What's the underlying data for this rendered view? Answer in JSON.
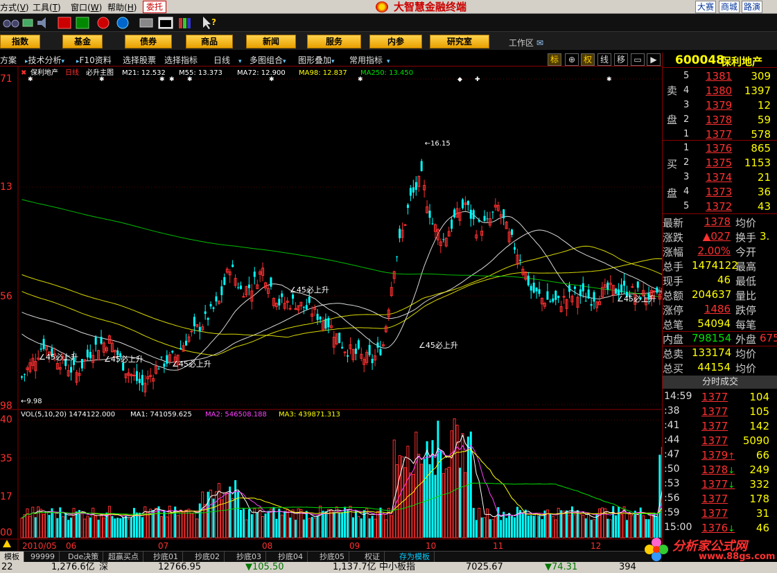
{
  "menubar": {
    "items": [
      {
        "label": "方式(",
        "key": "V",
        "close": ")"
      },
      {
        "label": "工具(",
        "key": "T",
        "close": ")"
      },
      {
        "label": "窗口(",
        "key": "W",
        "close": ")"
      },
      {
        "label": "帮助(",
        "key": "H",
        "close": ")"
      }
    ],
    "entrust": "委托",
    "title": "大智慧金融终端",
    "right_buttons": [
      "大赛",
      "商城",
      "路演"
    ]
  },
  "funcbar": {
    "buttons": [
      "指数",
      "基金",
      "债券",
      "商品",
      "新闻",
      "服务",
      "内参",
      "研究室"
    ],
    "workspace": "工作区"
  },
  "subbar": {
    "items": [
      "方案",
      "技术分析",
      "F10资料",
      "选择股票",
      "选择指标",
      "日线",
      "多图组合",
      "图形叠加",
      "常用指标"
    ],
    "modes": [
      "标",
      "⊕",
      "权",
      "线",
      "移",
      "",
      ""
    ]
  },
  "chart": {
    "legend_prefix": "保利地产",
    "legend_period": "日线",
    "legend_template": "必升主图",
    "ma_items": [
      {
        "label": "M21: 12.532",
        "color": "#ffffff"
      },
      {
        "label": "M55: 13.373",
        "color": "#ffffff"
      },
      {
        "label": "MA72: 12.900",
        "color": "#ffffff"
      },
      {
        "label": "MA98: 12.837",
        "color": "#ffff00"
      },
      {
        "label": "MA250: 13.450",
        "color": "#00e000"
      }
    ],
    "price_axis": [
      "71",
      "13",
      "56",
      "98"
    ],
    "high_label": "16.15",
    "low_label": "9.98",
    "signal_label": "45必上升",
    "vol_legend": [
      {
        "label": "VOL(5,10,20) 1474122.000",
        "color": "#ffffff"
      },
      {
        "label": "MA1: 741059.625",
        "color": "#ffffff"
      },
      {
        "label": "MA2: 546508.188",
        "color": "#ff40ff"
      },
      {
        "label": "MA3: 439871.313",
        "color": "#ffff00"
      }
    ],
    "vol_axis": [
      "40",
      "35",
      "17",
      "00"
    ],
    "date_axis": [
      "2010/05",
      "06",
      "07",
      "08",
      "09",
      "10",
      "11",
      "12"
    ]
  },
  "chart_data": {
    "type": "candlestick",
    "title": "保利地产 日线",
    "symbol": "600048",
    "y_range": [
      9.98,
      16.15
    ],
    "ma_last": {
      "M21": 12.532,
      "M55": 13.373,
      "MA72": 12.9,
      "MA98": 12.837,
      "MA250": 13.45
    },
    "volume_last": 1474122,
    "volume_ma": {
      "MA1": 741059.625,
      "MA2": 546508.188,
      "MA3": 439871.313
    }
  },
  "quote": {
    "code": "600048",
    "name": "保利地产",
    "sell_label": [
      "卖",
      "盘"
    ],
    "buy_label": [
      "买",
      "盘"
    ],
    "asks": [
      {
        "idx": "5",
        "price": "1381",
        "vol": "309"
      },
      {
        "idx": "4",
        "price": "1380",
        "vol": "1397"
      },
      {
        "idx": "3",
        "price": "1379",
        "vol": "12"
      },
      {
        "idx": "2",
        "price": "1378",
        "vol": "59"
      },
      {
        "idx": "1",
        "price": "1377",
        "vol": "578"
      }
    ],
    "bids": [
      {
        "idx": "1",
        "price": "1376",
        "vol": "865"
      },
      {
        "idx": "2",
        "price": "1375",
        "vol": "1153"
      },
      {
        "idx": "3",
        "price": "1374",
        "vol": "21"
      },
      {
        "idx": "4",
        "price": "1373",
        "vol": "36"
      },
      {
        "idx": "5",
        "price": "1372",
        "vol": "43"
      }
    ],
    "stats": [
      {
        "l1": "最新",
        "v1": "1378",
        "c1": "red",
        "l2": "均价",
        "v2": "",
        "c2": "red"
      },
      {
        "l1": "涨跌",
        "v1": "▲027",
        "c1": "red",
        "l2": "换手",
        "v2": "3.",
        "c2": "yellow"
      },
      {
        "l1": "涨幅",
        "v1": "2.00%",
        "c1": "red",
        "l2": "今开",
        "v2": "",
        "c2": "red"
      },
      {
        "l1": "总手",
        "v1": "1474122",
        "c1": "yellow",
        "l2": "最高",
        "v2": "",
        "c2": "red"
      },
      {
        "l1": "现手",
        "v1": "46",
        "c1": "yellow",
        "l2": "最低",
        "v2": "",
        "c2": "red"
      },
      {
        "l1": "总额",
        "v1": "204637",
        "c1": "yellow",
        "l2": "量比",
        "v2": "",
        "c2": "yellow"
      },
      {
        "l1": "涨停",
        "v1": "1486",
        "c1": "red",
        "l2": "跌停",
        "v2": "",
        "c2": "green"
      },
      {
        "l1": "总笔",
        "v1": "54094",
        "c1": "yellow",
        "l2": "每笔",
        "v2": "",
        "c2": "yellow"
      },
      {
        "l1": "内盘",
        "v1": "798154",
        "c1": "green",
        "l2": "外盘",
        "v2": "675",
        "c2": "red"
      },
      {
        "l1": "总卖",
        "v1": "133174",
        "c1": "yellow",
        "l2": "均价",
        "v2": "",
        "c2": "red"
      },
      {
        "l1": "总买",
        "v1": "44154",
        "c1": "yellow",
        "l2": "均价",
        "v2": "",
        "c2": "red"
      }
    ],
    "ticks_header": "分时成交",
    "ticks": [
      {
        "time": "14:59",
        "price": "1377",
        "vol": "104",
        "color": "red",
        "arrow": ""
      },
      {
        "time": ":38",
        "price": "1377",
        "vol": "105",
        "color": "red",
        "arrow": ""
      },
      {
        "time": ":41",
        "price": "1377",
        "vol": "142",
        "color": "red",
        "arrow": ""
      },
      {
        "time": ":44",
        "price": "1377",
        "vol": "5090",
        "color": "red",
        "arrow": ""
      },
      {
        "time": ":47",
        "price": "1379",
        "vol": "66",
        "color": "red",
        "arrow": "↑"
      },
      {
        "time": ":50",
        "price": "1378",
        "vol": "249",
        "color": "red",
        "arrow": "↓"
      },
      {
        "time": ":53",
        "price": "1377",
        "vol": "332",
        "color": "red",
        "arrow": "↓"
      },
      {
        "time": ":56",
        "price": "1377",
        "vol": "178",
        "color": "red",
        "arrow": ""
      },
      {
        "time": ":59",
        "price": "1377",
        "vol": "31",
        "color": "red",
        "arrow": ""
      },
      {
        "time": "15:00",
        "price": "1376",
        "vol": "46",
        "color": "red",
        "arrow": "↓"
      }
    ]
  },
  "tabs": [
    "模板",
    "99999",
    "Dde决策",
    "超赢买点",
    "抄底01",
    "抄底02",
    "抄底03",
    "抄底04",
    "抄底05",
    "权证",
    "存为模板"
  ],
  "statusbar": {
    "a": "22",
    "b": "1,276.6亿",
    "c": "深",
    "d": "12766.95",
    "e": "▼105.50",
    "f": "1,137.7亿",
    "g": "中小板指",
    "h": "7025.67",
    "i": "▼74.31",
    "j": "394"
  },
  "watermark": {
    "text": "分析家公式网",
    "url": "www.88gs.com"
  }
}
